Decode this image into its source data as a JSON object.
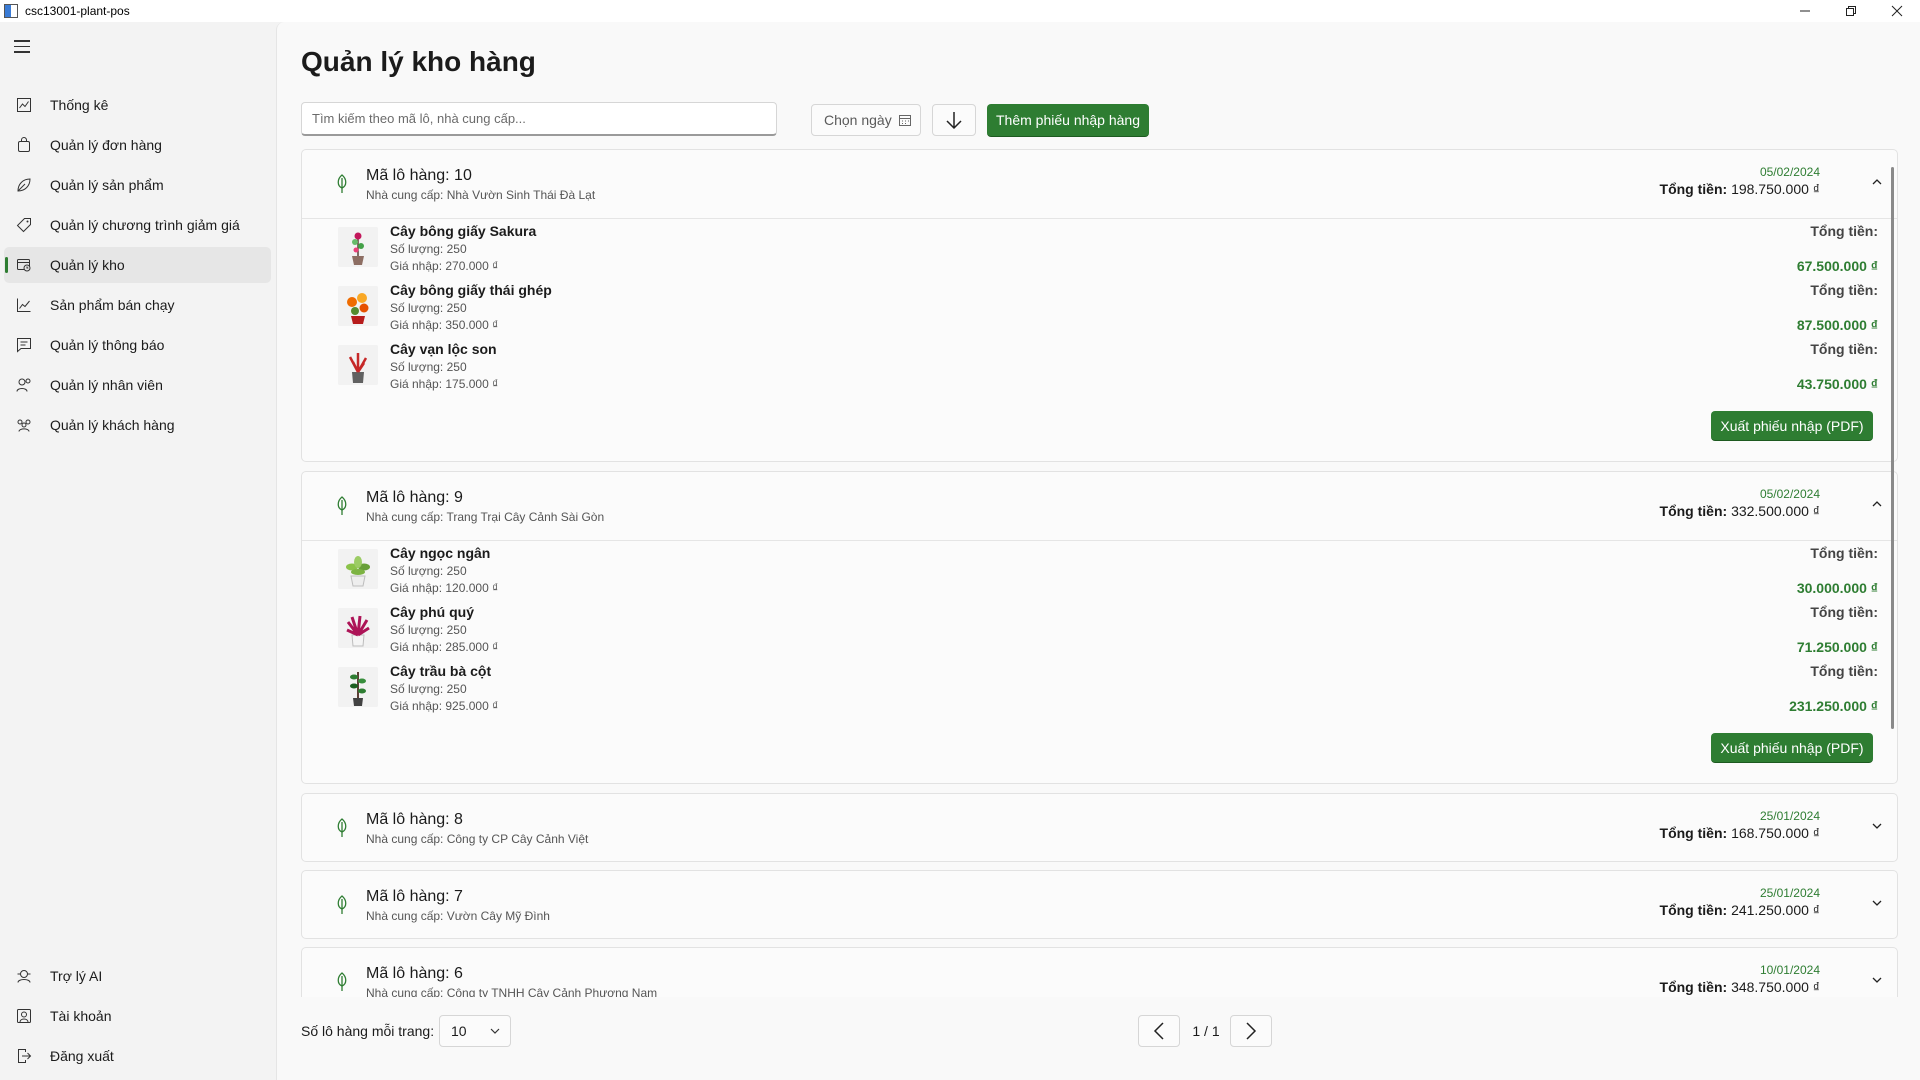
{
  "window": {
    "title": "csc13001-plant-pos"
  },
  "sidebar": {
    "items": [
      {
        "label": "Thống kê",
        "icon": "chart-icon"
      },
      {
        "label": "Quản lý đơn hàng",
        "icon": "bag-icon"
      },
      {
        "label": "Quản lý sản phẩm",
        "icon": "plant-icon"
      },
      {
        "label": "Quản lý chương trình giảm giá",
        "icon": "tag-icon"
      },
      {
        "label": "Quản lý kho",
        "icon": "warehouse-icon",
        "active": true
      },
      {
        "label": "Sản phẩm bán chạy",
        "icon": "trend-icon"
      },
      {
        "label": "Quản lý thông báo",
        "icon": "notification-icon"
      },
      {
        "label": "Quản lý nhân viên",
        "icon": "people-icon"
      },
      {
        "label": "Quản lý khách hàng",
        "icon": "customers-icon"
      }
    ],
    "bottom": [
      {
        "label": "Trợ lý AI",
        "icon": "bot-icon"
      },
      {
        "label": "Tài khoản",
        "icon": "account-icon"
      },
      {
        "label": "Đăng xuất",
        "icon": "logout-icon"
      }
    ]
  },
  "main": {
    "title": "Quản lý kho hàng",
    "search_placeholder": "Tìm kiếm theo mã lô, nhà cung cấp...",
    "date_picker_label": "Chọn ngày",
    "add_button": "Thêm phiếu nhập hàng"
  },
  "labels": {
    "total": "Tổng tiền:",
    "export": "Xuất phiếu nhập (PDF)"
  },
  "batches": [
    {
      "code": "Mã lô hàng: 10",
      "supplier": "Nhà cung cấp: Nhà Vườn Sinh Thái Đà Lạt",
      "date": "05/02/2024",
      "total": "198.750.000 ₫",
      "expanded": true,
      "items": [
        {
          "name": "Cây bông giấy Sakura",
          "qty": "Số lượng: 250",
          "price": "Giá nhập: 270.000 ₫",
          "total": "67.500.000 ₫",
          "color": "#c2185b"
        },
        {
          "name": "Cây bông giấy thái ghép",
          "qty": "Số lượng: 250",
          "price": "Giá nhập: 350.000 ₫",
          "total": "87.500.000 ₫",
          "color": "#e65100"
        },
        {
          "name": "Cây vạn lộc son",
          "qty": "Số lượng: 250",
          "price": "Giá nhập: 175.000 ₫",
          "total": "43.750.000 ₫",
          "color": "#d32f2f"
        }
      ]
    },
    {
      "code": "Mã lô hàng: 9",
      "supplier": "Nhà cung cấp: Trang Trại Cây Cảnh Sài Gòn",
      "date": "05/02/2024",
      "total": "332.500.000 ₫",
      "expanded": true,
      "items": [
        {
          "name": "Cây ngọc ngân",
          "qty": "Số lượng: 250",
          "price": "Giá nhập: 120.000 ₫",
          "total": "30.000.000 ₫",
          "color": "#7cb342"
        },
        {
          "name": "Cây phú quý",
          "qty": "Số lượng: 250",
          "price": "Giá nhập: 285.000 ₫",
          "total": "71.250.000 ₫",
          "color": "#c62828"
        },
        {
          "name": "Cây trầu bà cột",
          "qty": "Số lượng: 250",
          "price": "Giá nhập: 925.000 ₫",
          "total": "231.250.000 ₫",
          "color": "#2e7d32"
        }
      ]
    },
    {
      "code": "Mã lô hàng: 8",
      "supplier": "Nhà cung cấp: Công ty CP Cây Cảnh Việt",
      "date": "25/01/2024",
      "total": "168.750.000 ₫",
      "expanded": false
    },
    {
      "code": "Mã lô hàng: 7",
      "supplier": "Nhà cung cấp: Vườn Cây Mỹ Đình",
      "date": "25/01/2024",
      "total": "241.250.000 ₫",
      "expanded": false
    },
    {
      "code": "Mã lô hàng: 6",
      "supplier": "Nhà cung cấp: Công ty TNHH Cây Cảnh Phương Nam",
      "date": "10/01/2024",
      "total": "348.750.000 ₫",
      "expanded": false
    }
  ],
  "footer": {
    "per_page_label": "Số lô hàng mỗi trang:",
    "per_page_value": "10",
    "page_indicator": "1 / 1"
  },
  "colors": {
    "accent": "#2e7d32"
  }
}
